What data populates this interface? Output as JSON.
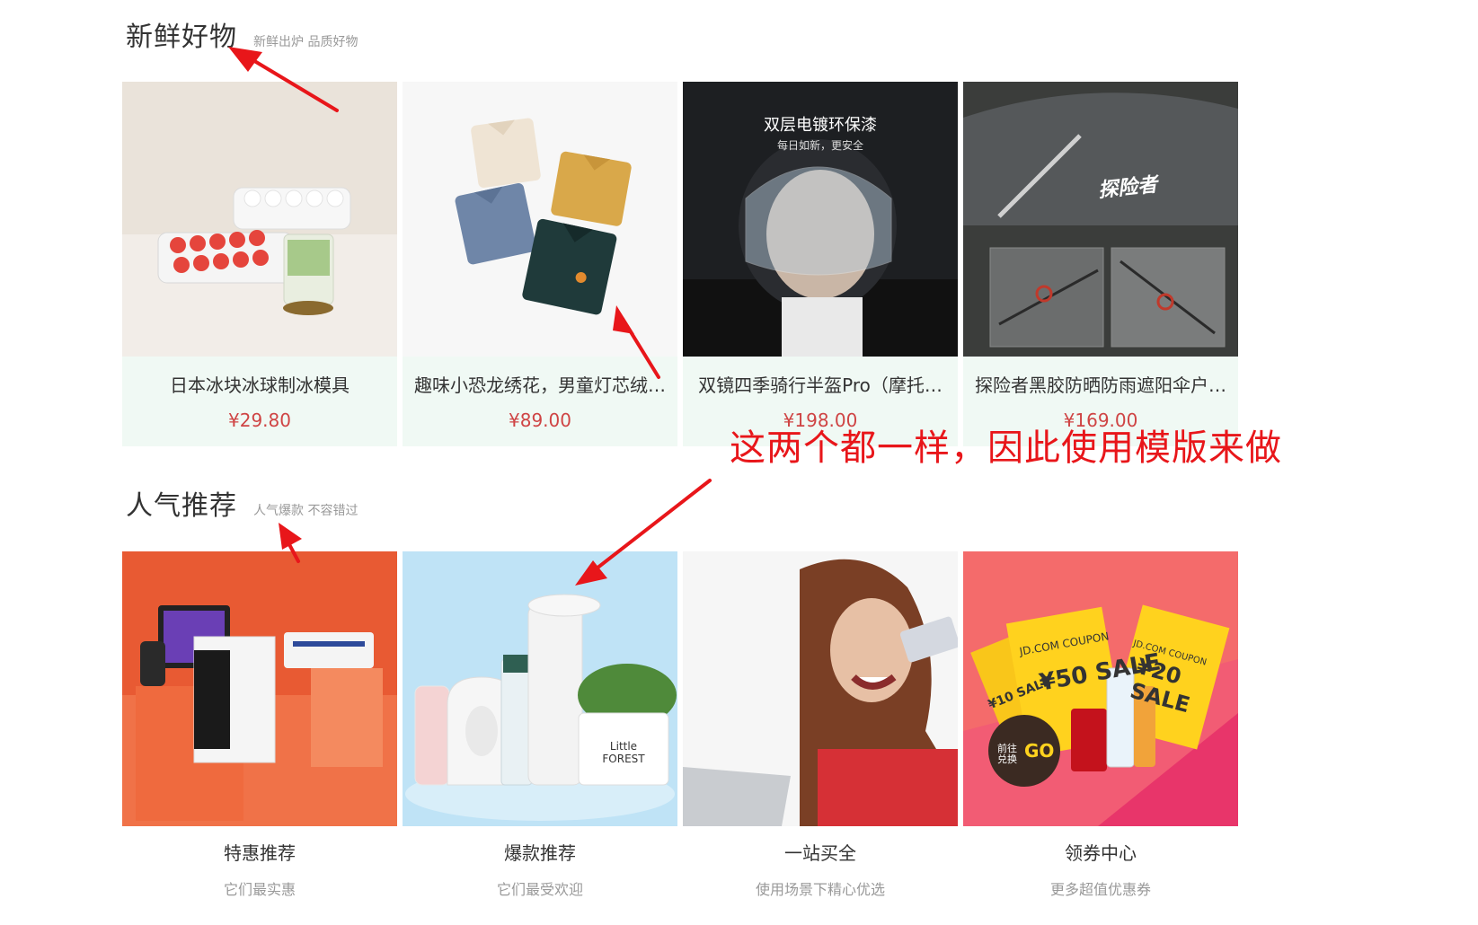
{
  "sections": {
    "fresh": {
      "title": "新鲜好物",
      "subtitle": "新鲜出炉 品质好物"
    },
    "hot": {
      "title": "人气推荐",
      "subtitle": "人气爆款 不容错过"
    }
  },
  "fresh_goods": [
    {
      "name": "日本冰块冰球制冰模具",
      "price": "¥29.80",
      "image_text": ""
    },
    {
      "name": "趣味小恐龙绣花，男童灯芯绒…",
      "price": "¥89.00",
      "image_text": ""
    },
    {
      "name": "双镜四季骑行半盔Pro（摩托…",
      "price": "¥198.00",
      "image_text": "双层电镀环保漆",
      "image_subtext": "每日如新，更安全"
    },
    {
      "name": "探险者黑胶防晒防雨遮阳伞户…",
      "price": "¥169.00",
      "image_text": "探险者"
    }
  ],
  "hot_items": [
    {
      "title": "特惠推荐",
      "desc": "它们最实惠"
    },
    {
      "title": "爆款推荐",
      "desc": "它们最受欢迎"
    },
    {
      "title": "一站买全",
      "desc": "使用场景下精心优选"
    },
    {
      "title": "领券中心",
      "desc": "更多超值优惠券"
    }
  ],
  "coupon_texts": {
    "coupon_label": "JD.COM COUPON",
    "coupon_1": "¥50 SALE",
    "coupon_2": "¥20 SALE",
    "coupon_3": "¥10 SALE",
    "go_label": "前往兑换",
    "go": "GO"
  },
  "plant_pot_text": "Little FOREST",
  "annotation": {
    "note": "这两个都一样，因此使用模版来做",
    "color": "#e8161a"
  },
  "colors": {
    "price": "#cf4444",
    "fresh_info_bg": "#f0f9f4",
    "annotation": "#e8161a"
  }
}
